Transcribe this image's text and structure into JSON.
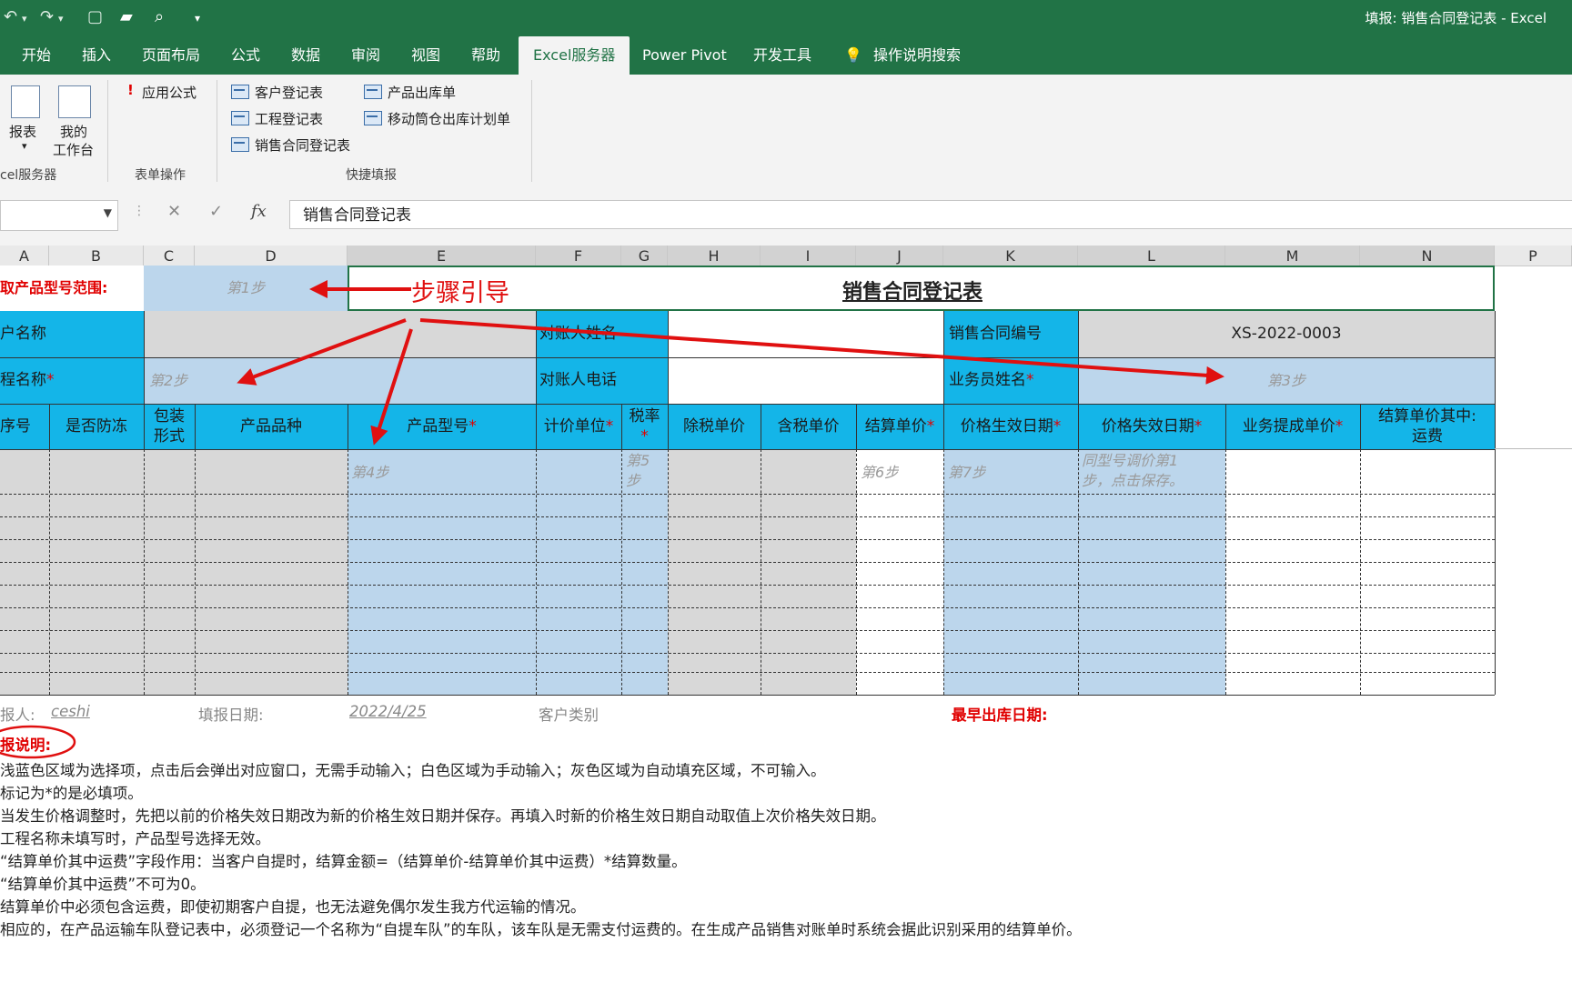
{
  "window": {
    "title": "填报: 销售合同登记表  -  Excel"
  },
  "ribbon_tabs": [
    {
      "label": "开始"
    },
    {
      "label": "插入"
    },
    {
      "label": "页面布局"
    },
    {
      "label": "公式"
    },
    {
      "label": "数据"
    },
    {
      "label": "审阅"
    },
    {
      "label": "视图"
    },
    {
      "label": "帮助"
    },
    {
      "label": "Excel服务器",
      "active": true
    },
    {
      "label": "Power Pivot"
    },
    {
      "label": "开发工具"
    },
    {
      "label": "操作说明搜索"
    }
  ],
  "ribbon": {
    "group1": {
      "label": "cel服务器",
      "report_button": "报表",
      "workbench_line1": "我的",
      "workbench_line2": "工作台"
    },
    "group2": {
      "label": "表单操作",
      "apply_formula": "应用公式"
    },
    "group3": {
      "label": "快捷填报",
      "items": [
        "客户登记表",
        "工程登记表",
        "销售合同登记表",
        "产品出库单",
        "移动筒仓出库计划单"
      ]
    }
  },
  "formula_bar": {
    "name_box": "",
    "formula": "销售合同登记表"
  },
  "columns": [
    "A",
    "B",
    "C",
    "D",
    "E",
    "F",
    "G",
    "H",
    "I",
    "J",
    "K",
    "L",
    "M",
    "N",
    "P"
  ],
  "sheet": {
    "row1": {
      "label": "取产品型号范围:",
      "step1": "第1步",
      "annotation": "步骤引导",
      "title": "销售合同登记表"
    },
    "row2": {
      "customer_name": "户名称",
      "reconciler_name": "对账人姓名",
      "contract_no_label": "销售合同编号",
      "contract_no_value": "XS-2022-0003"
    },
    "row3": {
      "project_name": "程名称",
      "step2": "第2步",
      "reconciler_phone": "对账人电话",
      "salesman_name": "业务员姓名",
      "step3": "第3步"
    },
    "headers": {
      "seq": "序号",
      "antifreeze": "是否防冻",
      "package_line1": "包装",
      "package_line2": "形式",
      "variety": "产品品种",
      "model": "产品型号",
      "unit": "计价单位",
      "tax_line1": "税率",
      "price_ex_tax": "除税单价",
      "price_inc_tax": "含税单价",
      "settle_price": "结算单价",
      "effective_date": "价格生效日期",
      "expire_date": "价格失效日期",
      "commission": "业务提成单价",
      "freight_line1": "结算单价其中:",
      "freight_line2": "运费"
    },
    "hints": {
      "step4": "第4步",
      "step5_line1": "第5",
      "step5_line2": "步",
      "step6": "第6步",
      "step7": "第7步",
      "expire_line1": "同型号调价第1",
      "expire_line2": "步，点击保存。"
    },
    "footer": {
      "reporter_label": "报人:",
      "reporter_value": "ceshi",
      "date_label": "填报日期:",
      "date_value": "2022/4/25",
      "customer_type_label": "客户类别",
      "earliest_date_label": "最早出库日期:"
    }
  },
  "instructions": {
    "title": "报说明:",
    "lines": [
      "浅蓝色区域为选择项，点击后会弹出对应窗口，无需手动输入；白色区域为手动输入；灰色区域为自动填充区域，不可输入。",
      "标记为*的是必填项。",
      "当发生价格调整时，先把以前的价格失效日期改为新的价格生效日期并保存。再填入时新的价格生效日期自动取值上次价格失效日期。",
      "工程名称未填写时，产品型号选择无效。",
      "“结算单价其中运费”字段作用：当客户自提时，结算金额=（结算单价-结算单价其中运费）*结算数量。",
      "“结算单价其中运费”不可为0。",
      "结算单价中必须包含运费，即使初期客户自提，也无法避免偶尔发生我方代运输的情况。",
      "相应的，在产品运输车队登记表中，必须登记一个名称为“自提车队”的车队，该车队是无需支付运费的。在生成产品销售对账单时系统会据此识别采用的结算单价。"
    ]
  },
  "colors": {
    "excel_green": "#217346",
    "header_cyan": "#14b5e8",
    "light_blue": "#bcd6ec",
    "gray": "#d8d8d8",
    "arrow_red": "#e01010"
  }
}
